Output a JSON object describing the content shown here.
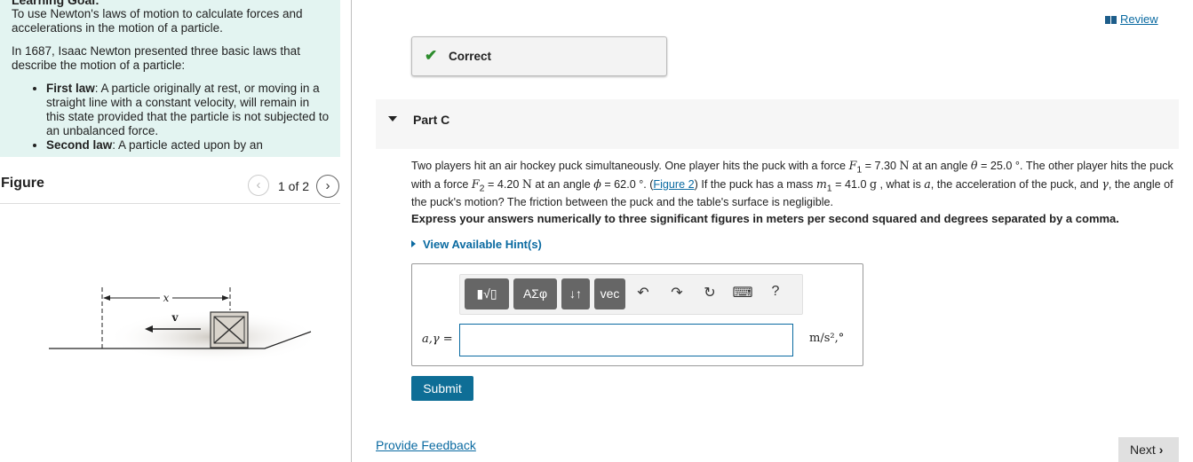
{
  "learning": {
    "title": "Learning Goal:",
    "intro": "To use Newton's laws of motion to calculate forces and accelerations in the motion of a particle.",
    "history": "In 1687, Isaac Newton presented three basic laws that describe the motion of a particle:",
    "laws": [
      {
        "name": "First law",
        "text": ": A particle originally at rest, or moving in a straight line with a constant velocity, will remain in this state provided that the particle is not subjected to an unbalanced force."
      },
      {
        "name": "Second law",
        "text": ": A particle acted upon by an"
      }
    ]
  },
  "figure": {
    "title": "Figure",
    "counter": "1 of 2",
    "prev_icon": "chevron-left-icon",
    "next_icon": "chevron-right-icon",
    "labels": {
      "x": "x",
      "v": "v"
    }
  },
  "header": {
    "review_label": "Review",
    "review_icon": "book-icon"
  },
  "status": {
    "label": "Correct",
    "icon": "checkmark-icon",
    "color": "#2c8c2c"
  },
  "part": {
    "title": "Part C"
  },
  "question": {
    "p1": "Two players hit an air hockey puck simultaneously.  One player hits the puck with a force ",
    "F1": "F",
    "F1_sub": "1",
    "p2": " = 7.30 ",
    "unitN1": "N",
    "p3": " at an angle ",
    "theta": "θ",
    "p4": " = 25.0 °.  The other player hits the puck with a force ",
    "F2": "F",
    "F2_sub": "2",
    "p5": " = 4.20 ",
    "unitN2": "N",
    "p6": " at an angle ",
    "phi": "ϕ",
    "p7": " = 62.0 °. (",
    "figure_link": "Figure 2",
    "p8": ") If the puck has a mass ",
    "m": "m",
    "m_sub": "1",
    "p9": " = 41.0 ",
    "unitg": "g",
    "p10": " , what is ",
    "a": "a",
    "p11": ", the acceleration of the puck, and ",
    "gamma": "γ",
    "p12": ", the angle of the puck's motion?  The friction between the puck and the table's surface is negligible."
  },
  "instruction": "Express your answers numerically to three significant figures in meters per second squared and degrees separated by a comma.",
  "hints_label": "View Available Hint(s)",
  "toolbar": {
    "template_label": "▮√▯",
    "greek_label": "AΣφ",
    "arrows_label": "↓↑",
    "vec_label": "vec",
    "undo_icon": "undo-icon",
    "redo_icon": "redo-icon",
    "reset_icon": "reset-icon",
    "keyboard_icon": "keyboard-icon",
    "help_label": "?"
  },
  "answer": {
    "label": "a,γ =",
    "value": "",
    "units": "m/s²,°"
  },
  "submit_label": "Submit",
  "feedback_label": "Provide Feedback",
  "next_label": "Next"
}
